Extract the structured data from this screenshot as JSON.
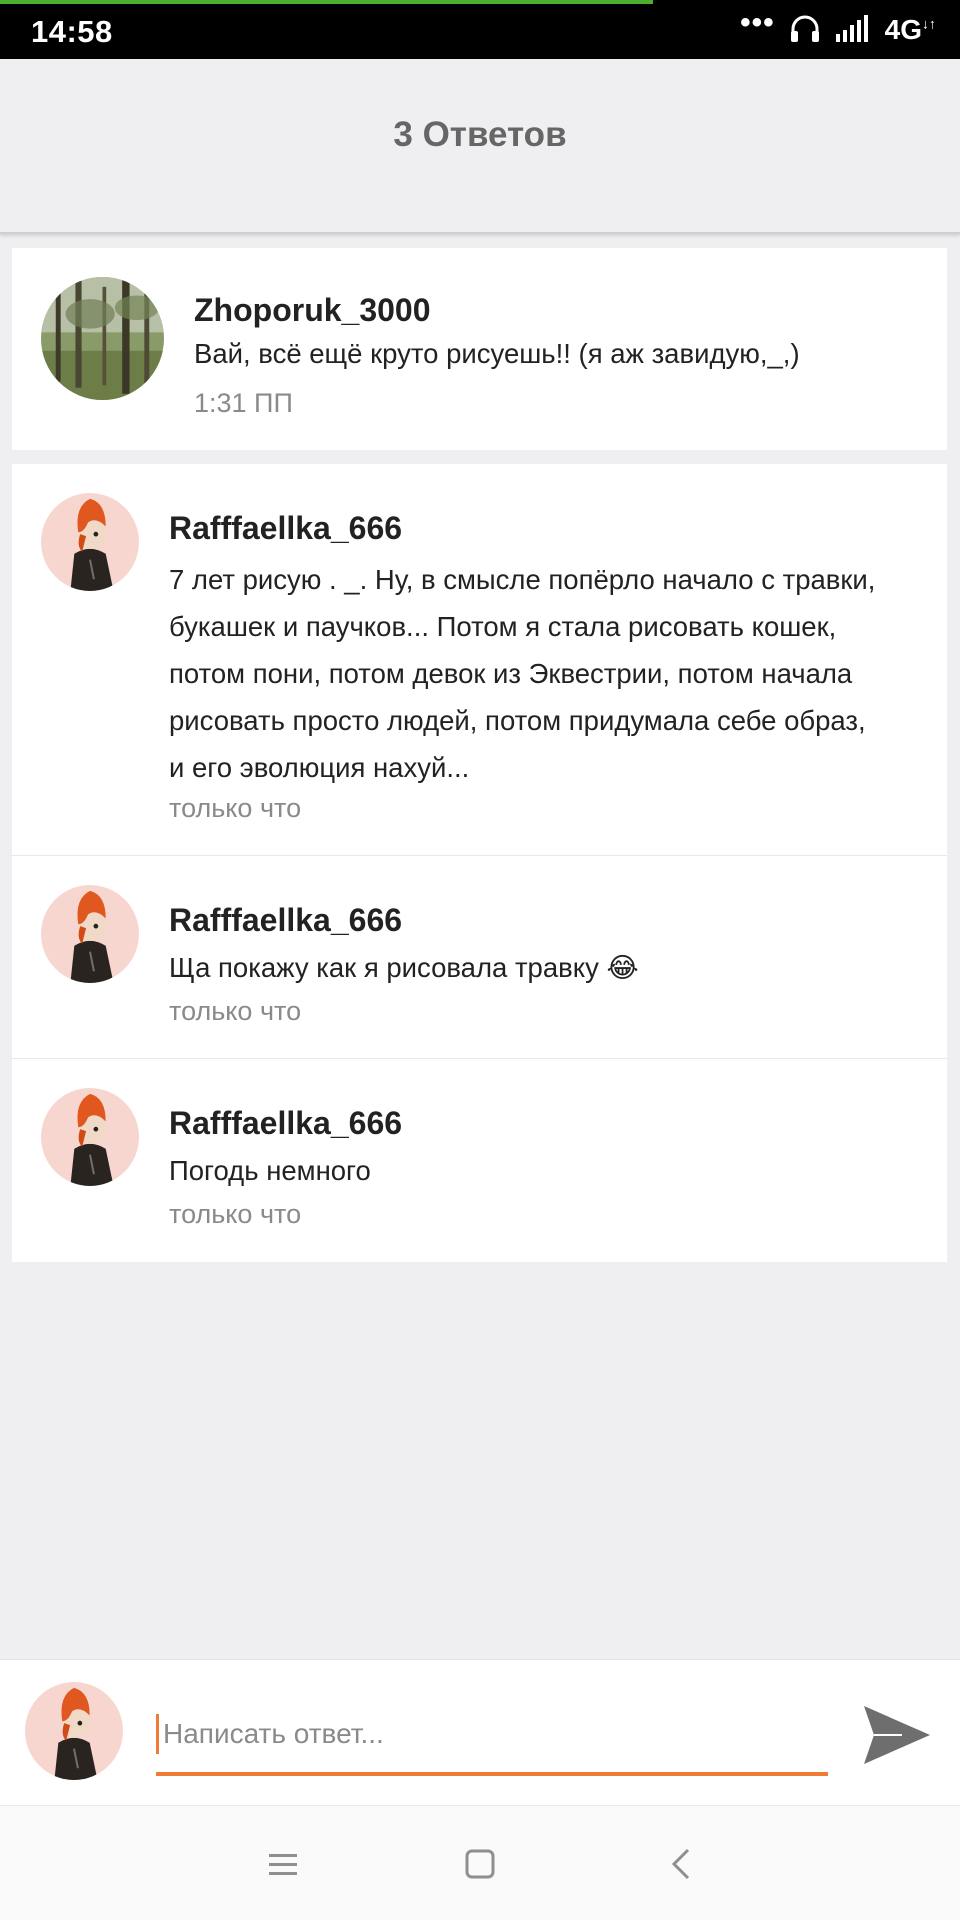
{
  "status_bar": {
    "time": "14:58",
    "dots": "•••",
    "network": "4G",
    "network_sub": "↓↑",
    "icons": [
      "headphones-icon",
      "signal-icon"
    ]
  },
  "header": {
    "title": "3 Ответов"
  },
  "parent_comment": {
    "author": "Zhoporuk_3000",
    "text": "Вай, всё ещё круто рисуешь!! (я аж завидую,_,)",
    "time": "1:31 ПП"
  },
  "replies": [
    {
      "author": "Rafffaellka_666",
      "lines": [
        "7 лет рисую . _. Ну, в смысле попёрло начало с травки,",
        "букашек и паучков... Потом я стала рисовать кошек,",
        "потом пони, потом девок из Эквестрии, потом начала",
        "рисовать просто людей, потом придумала себе образ,",
        "и его эволюция нахуй..."
      ],
      "time": "только что"
    },
    {
      "author": "Rafffaellka_666",
      "text": "Ща покажу как я рисовала травку 😂",
      "time": "только что"
    },
    {
      "author": "Rafffaellka_666",
      "text": "Погодь немного",
      "time": "только что"
    }
  ],
  "reply_bar": {
    "placeholder": "Написать ответ...",
    "value": ""
  },
  "colors": {
    "accent": "#ef7b35",
    "background": "#efeef1",
    "status_progress": "#4caf2f"
  }
}
